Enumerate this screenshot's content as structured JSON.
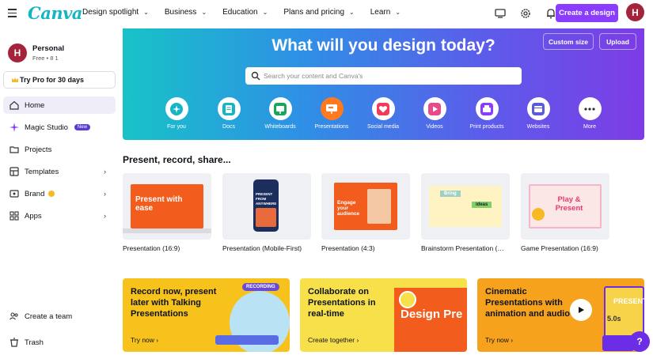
{
  "brand": {
    "logo_text": "Canva",
    "accent": "#8b3dff"
  },
  "nav": {
    "items": [
      {
        "label": "Design spotlight"
      },
      {
        "label": "Business"
      },
      {
        "label": "Education"
      },
      {
        "label": "Plans and pricing"
      },
      {
        "label": "Learn"
      }
    ],
    "create_label": "Create a design",
    "avatar_initial": "H"
  },
  "sidebar": {
    "account_name": "Personal",
    "account_sub": "Free • 8 1",
    "try_pro": "Try Pro for 30 days",
    "items": [
      {
        "label": "Home"
      },
      {
        "label": "Magic Studio",
        "badge": "New"
      },
      {
        "label": "Projects"
      },
      {
        "label": "Templates"
      },
      {
        "label": "Brand"
      },
      {
        "label": "Apps"
      }
    ],
    "bottom": [
      {
        "label": "Create a team"
      },
      {
        "label": "Trash"
      }
    ]
  },
  "hero": {
    "title": "What will you design today?",
    "custom_size": "Custom size",
    "upload": "Upload",
    "search_placeholder": "Search your content and Canva's",
    "categories": [
      {
        "label": "For you",
        "icon": "sparkle-icon",
        "color": "#14b5c4"
      },
      {
        "label": "Docs",
        "icon": "doc-icon",
        "color": "#14b5c4"
      },
      {
        "label": "Whiteboards",
        "icon": "whiteboard-icon",
        "color": "#1aa55a"
      },
      {
        "label": "Presentations",
        "icon": "presentation-icon",
        "color": "#ff7a1f",
        "selected": true
      },
      {
        "label": "Social media",
        "icon": "heart-icon",
        "color": "#f23a5b"
      },
      {
        "label": "Videos",
        "icon": "video-icon",
        "color": "#e94a8a"
      },
      {
        "label": "Print products",
        "icon": "print-icon",
        "color": "#8b3dff"
      },
      {
        "label": "Websites",
        "icon": "website-icon",
        "color": "#5b5bd6"
      },
      {
        "label": "More",
        "icon": "more-icon",
        "color": "#333"
      }
    ]
  },
  "section": {
    "title": "Present, record, share..."
  },
  "templates": [
    {
      "label": "Presentation (16:9)",
      "card_text": "Present with ease"
    },
    {
      "label": "Presentation (Mobile-First)",
      "card_text": "PRESENT FROM ANYWHERE"
    },
    {
      "label": "Presentation (4:3)",
      "card_text": "Engage your audience"
    },
    {
      "label": "Brainstorm Presentation (…",
      "card_text_a": "Bring",
      "card_text_b": "ideas"
    },
    {
      "label": "Game Presentation (16:9)",
      "card_text": "Play & Present"
    }
  ],
  "promos": [
    {
      "title": "Record now, present later with Talking Presentations",
      "link": "Try now",
      "tag": "RECORDING"
    },
    {
      "title": "Collaborate on Presentations in real-time",
      "link": "Create together",
      "tag": "Design Pre"
    },
    {
      "title": "Cinematic Presentations with animation and audio",
      "link": "Try now",
      "tag": "PRESENT",
      "timer": "5.0s"
    }
  ],
  "help": "?"
}
